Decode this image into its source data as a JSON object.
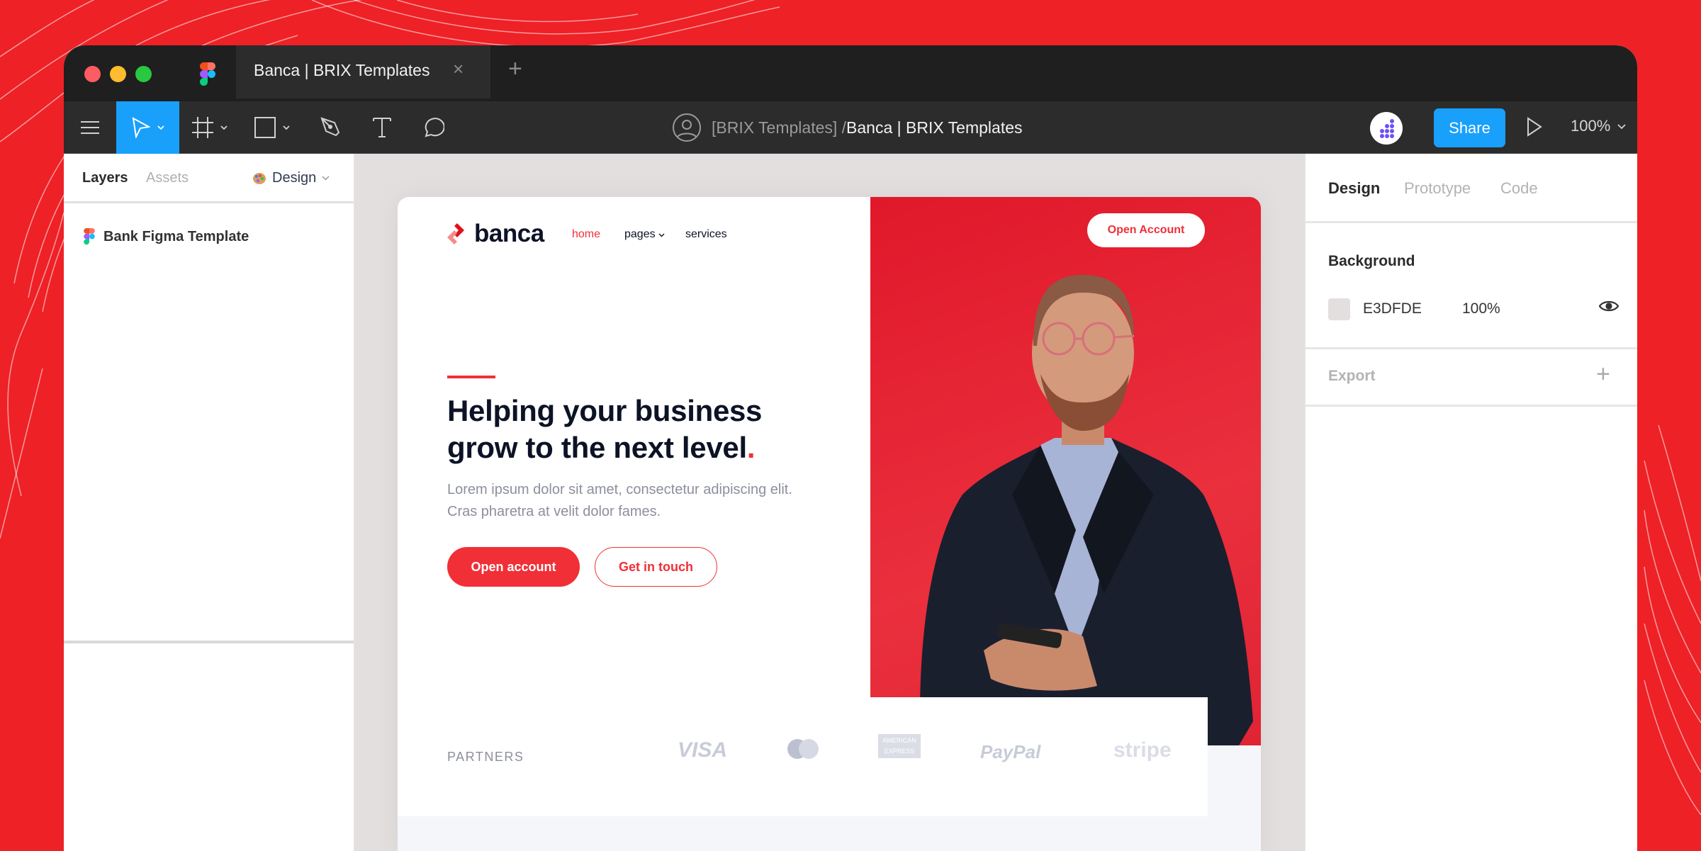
{
  "window": {
    "tab_title": "Banca | BRIX Templates",
    "tab_close": "×",
    "tab_add": "+"
  },
  "toolbar": {
    "tools": [
      "menu-icon",
      "move-tool",
      "frame-tool",
      "shape-tool",
      "pen-tool",
      "text-tool",
      "comment-tool"
    ],
    "active_tool": "move-tool",
    "path_team": "[BRIX Templates] /",
    "path_file": "Banca | BRIX Templates",
    "share_label": "Share",
    "zoom_level": "100%",
    "accent_color": "#18a0fb"
  },
  "left_panel": {
    "tabs": [
      "Layers",
      "Assets"
    ],
    "active_tab": "Layers",
    "page_selector": "Design",
    "layers": [
      {
        "name": "Bank Figma Template"
      }
    ]
  },
  "canvas": {
    "background": "#E3DFDE",
    "site": {
      "brand": "banca",
      "nav": [
        "home",
        "pages",
        "services"
      ],
      "nav_active": "home",
      "cta_nav": "Open Account",
      "headline_main": "Helping your business grow to the next level",
      "headline_dot": ".",
      "subtext": "Lorem ipsum dolor sit amet, consectetur adipiscing elit. Cras pharetra at velit dolor fames.",
      "primary_button": "Open account",
      "secondary_button": "Get in touch",
      "partners_label": "PARTNERS",
      "partners": [
        "VISA",
        "Mastercard",
        "American Express",
        "PayPal",
        "stripe"
      ],
      "brand_color": "#F12F36"
    }
  },
  "right_panel": {
    "tabs": [
      "Design",
      "Prototype",
      "Code"
    ],
    "active_tab": "Design",
    "background_title": "Background",
    "background_hex": "E3DFDE",
    "background_opacity": "100%",
    "export_title": "Export",
    "export_add": "+"
  },
  "partner_text": {
    "visa": "VISA",
    "amex_1": "AMERICAN",
    "amex_2": "EXPRESS",
    "paypal": "PayPal",
    "stripe": "stripe"
  }
}
